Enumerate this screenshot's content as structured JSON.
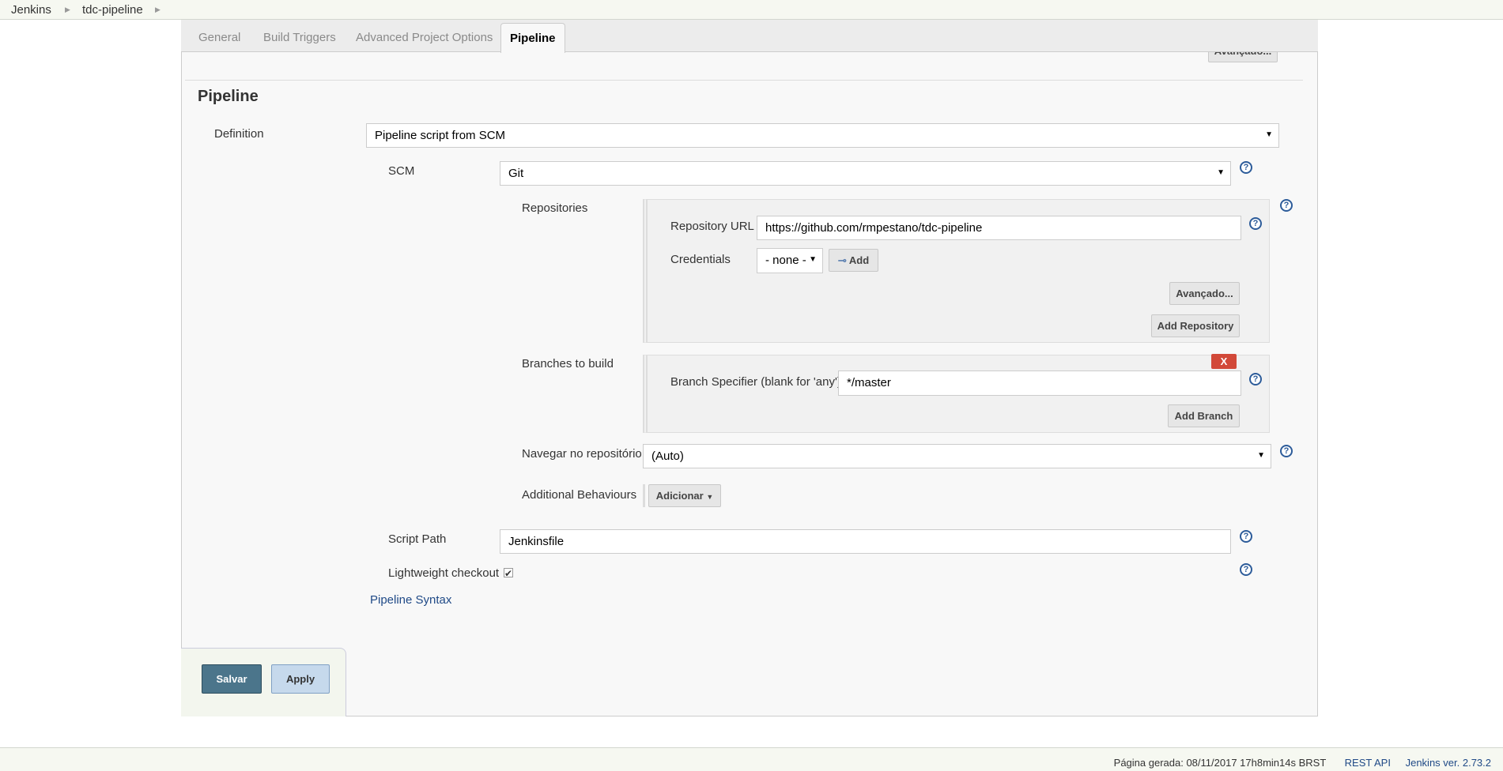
{
  "breadcrumb": [
    "Jenkins",
    "tdc-pipeline"
  ],
  "tabs": [
    "General",
    "Build Triggers",
    "Advanced Project Options",
    "Pipeline"
  ],
  "section_title": "Pipeline",
  "top_advanced_label": "Avançado...",
  "definition": {
    "label": "Definition",
    "value": "Pipeline script from SCM"
  },
  "scm": {
    "label": "SCM",
    "value": "Git"
  },
  "repositories": {
    "label": "Repositories",
    "url_label": "Repository URL",
    "url_value": "https://github.com/rmpestano/tdc-pipeline",
    "credentials_label": "Credentials",
    "credentials_value": "- none -",
    "add_label": "Add",
    "advanced_label": "Avançado...",
    "add_repository_label": "Add Repository"
  },
  "branches": {
    "label": "Branches to build",
    "delete_label": "X",
    "specifier_label": "Branch Specifier (blank for 'any')",
    "specifier_value": "*/master",
    "add_branch_label": "Add Branch"
  },
  "browser": {
    "label": "Navegar no repositório",
    "value": "(Auto)"
  },
  "behaviours": {
    "label": "Additional Behaviours",
    "button_label": "Adicionar"
  },
  "script_path": {
    "label": "Script Path",
    "value": "Jenkinsfile"
  },
  "lightweight": {
    "label": "Lightweight checkout",
    "checked": true
  },
  "pipeline_syntax": "Pipeline Syntax",
  "buttons": {
    "save": "Salvar",
    "apply": "Apply"
  },
  "footer": {
    "generated": "Página gerada: 08/11/2017 17h8min14s BRST",
    "rest_api": "REST API",
    "version": "Jenkins ver. 2.73.2"
  },
  "colors": {
    "save_button": "#4b758b",
    "apply_button": "#c6d9ec",
    "delete_button": "#d24939",
    "help_icon": "#2d5c9a"
  }
}
